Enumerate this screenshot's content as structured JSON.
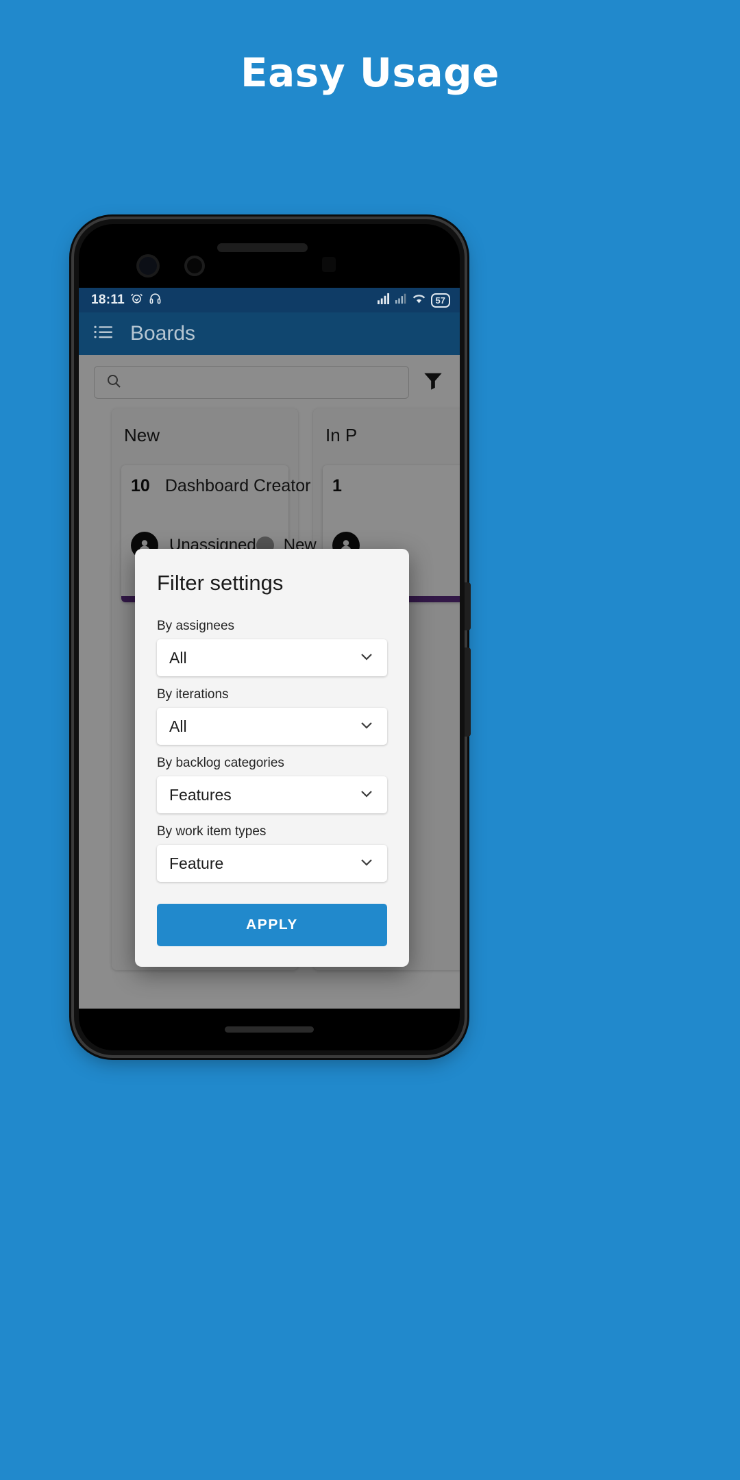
{
  "headline": "Easy Usage",
  "theme": {
    "brand_blue": "#2189cc",
    "appbar_blue": "#10466f",
    "statusbar_blue": "#0f3c66",
    "card_accent": "#5b2d82"
  },
  "status_bar": {
    "time": "18:11",
    "icons": [
      "alarm-icon",
      "headphones-icon",
      "signal-icon",
      "signal-alt-icon",
      "wifi-icon"
    ],
    "battery_level": "57"
  },
  "app_bar": {
    "menu_icon": "list-menu-icon",
    "title": "Boards"
  },
  "search": {
    "icon": "search-icon",
    "value": "",
    "placeholder": "",
    "filter_icon": "filter-icon"
  },
  "board": {
    "columns": [
      {
        "title": "New",
        "cards": [
          {
            "id": "10",
            "title": "Dashboard Creator",
            "assignee": "Unassigned",
            "assignee_icon": "person-icon",
            "state": "New"
          }
        ]
      },
      {
        "title": "In P",
        "cards": [
          {
            "id": "1",
            "title": "",
            "assignee": "",
            "assignee_icon": "person-icon",
            "state": ""
          }
        ]
      }
    ]
  },
  "dialog": {
    "title": "Filter settings",
    "fields": [
      {
        "label": "By assignees",
        "value": "All",
        "icon": "chevron-down-icon"
      },
      {
        "label": "By iterations",
        "value": "All",
        "icon": "chevron-down-icon"
      },
      {
        "label": "By backlog categories",
        "value": "Features",
        "icon": "chevron-down-icon"
      },
      {
        "label": "By work item types",
        "value": "Feature",
        "icon": "chevron-down-icon"
      }
    ],
    "apply_label": "APPLY"
  }
}
